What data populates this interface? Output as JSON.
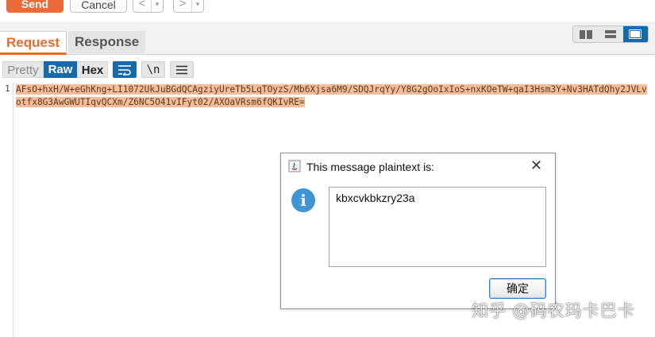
{
  "toolbar": {
    "send_label": "Send",
    "cancel_label": "Cancel",
    "back_glyph": "<",
    "forward_glyph": ">",
    "dropdown_glyph": "▾"
  },
  "tabs": {
    "request": "Request",
    "response": "Response"
  },
  "layout_buttons": [
    "split-columns-icon",
    "split-rows-icon",
    "single-panel-icon"
  ],
  "editor_toolbar": {
    "pretty": "Pretty",
    "raw": "Raw",
    "hex": "Hex",
    "newline_toggle": "\\n",
    "icons": [
      "word-wrap-icon",
      "menu-icon"
    ]
  },
  "editor": {
    "line_number": "1",
    "content": "AFsO+hxH/W+eGhKng+LI1072UkJuBGdQCAgziyUreTb5LqTOyzS/Mb6Xjsa6M9/SDQJrqYy/Y8G2gOoIxIoS+nxKOeTW+qaI3Hsm3Y+Nv3HATdQhy2JVLvotfx8G3AwGWUTIqvQCXm/Z6NC5O41vIFyt02/AXOaVRsm6fQKIvRE="
  },
  "dialog": {
    "title": "This message plaintext is:",
    "close_glyph": "✕",
    "info_glyph": "i",
    "message": "kbxcvkbkzry23a",
    "ok_label": "确定"
  },
  "watermark": "知乎 @码农玛卡巴卡",
  "colors": {
    "accent_orange": "#e56b2f",
    "send_button": "#ea6a3a",
    "active_blue": "#1769aa",
    "highlight": "#f7bd9a",
    "info_blue": "#3f95d6"
  }
}
